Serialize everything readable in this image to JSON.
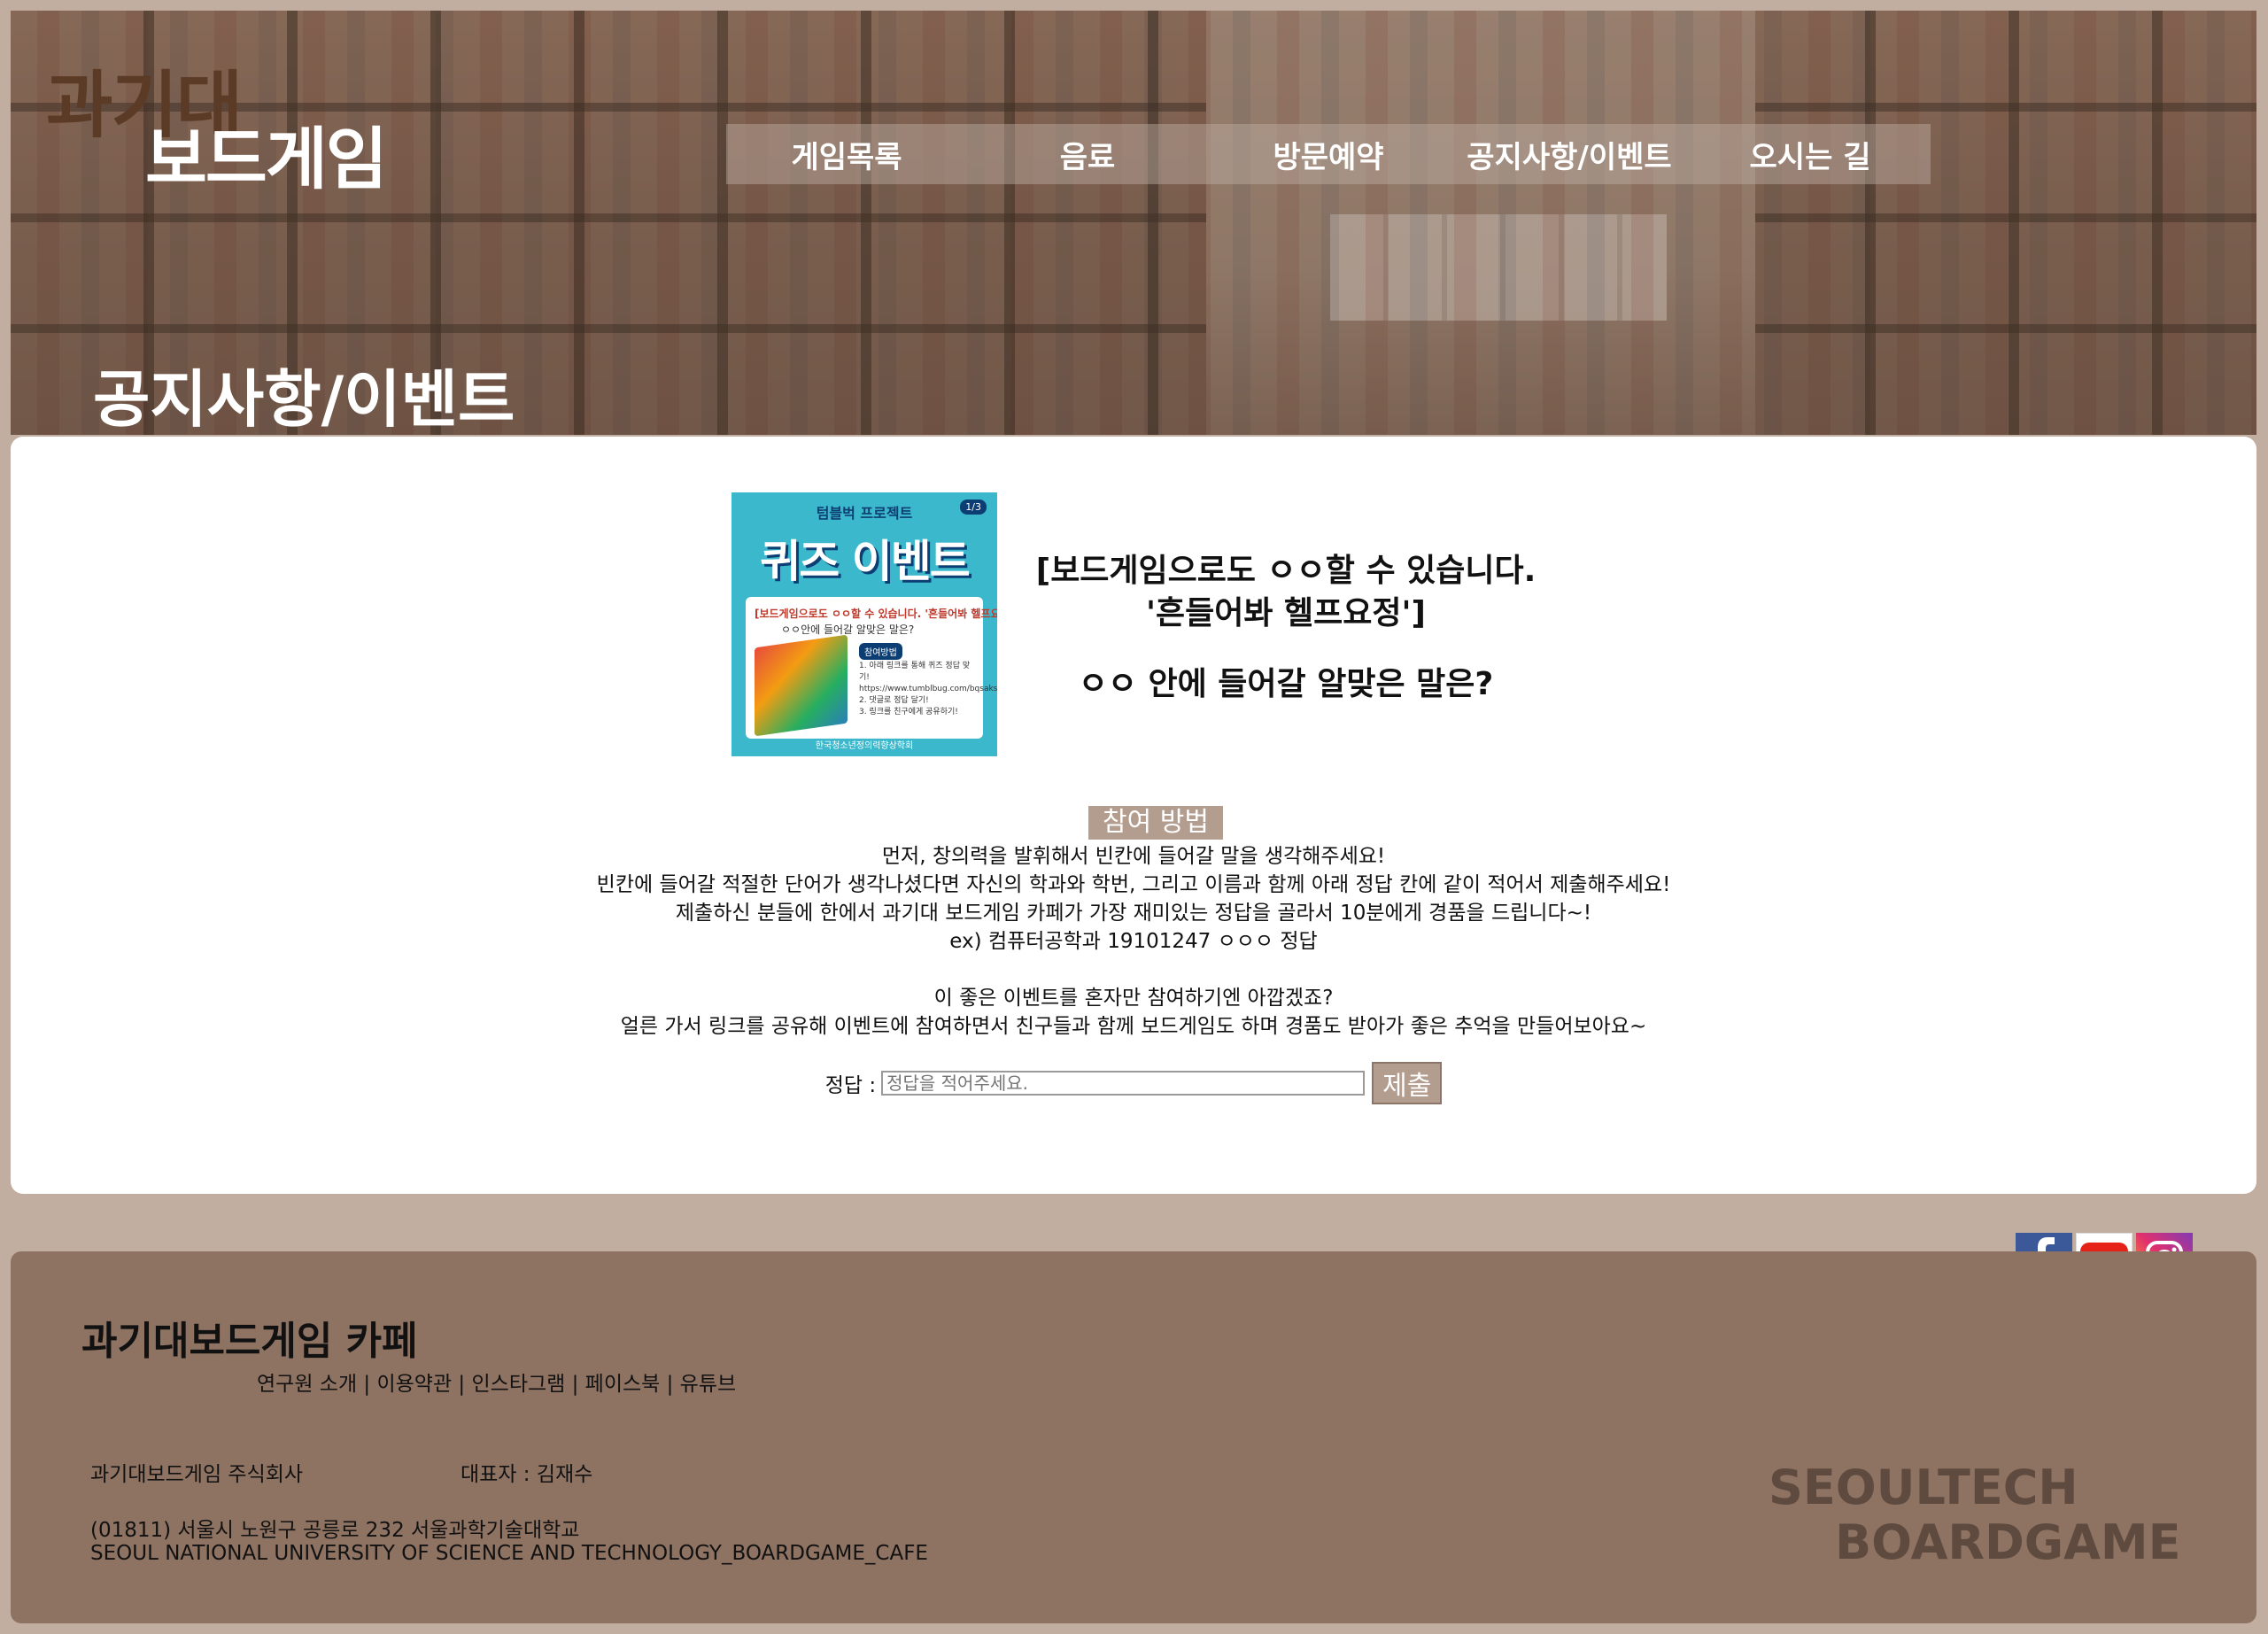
{
  "header": {
    "logo_top": "과기대",
    "logo_bottom": "보드게임",
    "nav": [
      "게임목록",
      "음료",
      "방문예약",
      "공지사항/이벤트",
      "오시는 길"
    ],
    "page_title": "공지사항/이벤트"
  },
  "poster": {
    "top_text": "텀블벅 프로젝트",
    "badge": "1/3",
    "title": "퀴즈 이벤트",
    "line1": "[보드게임으로도 ㅇㅇ할 수 있습니다. '흔들어봐 헬프요정']",
    "line2": "ㅇㅇ안에 들어갈 알맞은 말은?",
    "tag": "참여방법",
    "steps": [
      "1. 아래 링크를 통해 퀴즈 정답 맞기!",
      "https://www.tumblbug.com/bqsaksale",
      "2. 댓글로 정답 달기!",
      "3. 링크를 친구에게 공유하기!"
    ],
    "org": "한국청소년정의력향상학회"
  },
  "event": {
    "headline_1": "[보드게임으로도 ㅇㅇ할 수 있습니다.",
    "headline_2": "'흔들어봐 헬프요정']",
    "question": "ㅇㅇ 안에 들어갈 알맞은 말은?",
    "section_label": "참여 방법",
    "desc": [
      "먼저, 창의력을 발휘해서 빈칸에 들어갈 말을 생각해주세요!",
      "빈칸에 들어갈 적절한 단어가 생각나셨다면 자신의 학과와 학번, 그리고 이름과 함께 아래 정답 칸에 같이 적어서 제출해주세요!",
      "제출하신 분들에 한에서 과기대 보드게임 카페가 가장 재미있는 정답을 골라서 10분에게 경품을 드립니다~!",
      "ex) 컴퓨터공학과 19101247 ㅇㅇㅇ 정답",
      "이 좋은 이벤트를 혼자만 참여하기엔 아깝겠죠?",
      "얼른 가서 링크를 공유해 이벤트에 참여하면서 친구들과 함께 보드게임도 하며 경품도 받아가 좋은 추억을 만들어보아요~"
    ],
    "answer_label": "정답 :",
    "answer_placeholder": "정답을 적어주세요.",
    "submit": "제출"
  },
  "social": {
    "icons": [
      "facebook-icon",
      "youtube-icon",
      "instagram-icon"
    ],
    "facebook_letter": "f"
  },
  "footer": {
    "title": "과기대보드게임 카페",
    "links": "연구원 소개 | 이용약관 | 인스타그램 | 페이스북 | 유튜브",
    "company": "과기대보드게임 주식회사",
    "ceo": "대표자 : 김재수",
    "address": "(01811) 서울시 노원구 공릉로 232 서울과학기술대학교",
    "address_en": "SEOUL NATIONAL UNIVERSITY OF SCIENCE AND TECHNOLOGY_BOARDGAME_CAFE",
    "brand_1": "SEOULTECH",
    "brand_2": "BOARDGAME"
  },
  "colors": {
    "background": "#c1aea1",
    "footer": "#8e7262",
    "accent": "#b39d8f"
  }
}
